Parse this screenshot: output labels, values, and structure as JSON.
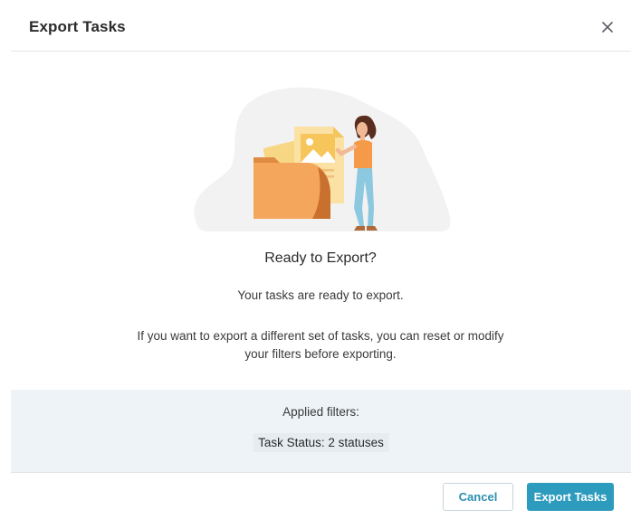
{
  "dialog": {
    "title": "Export Tasks",
    "close_icon": "close-icon"
  },
  "illustration": {
    "icon": "folder-with-documents-illustration"
  },
  "content": {
    "heading": "Ready to Export?",
    "description": "Your tasks are ready to export.",
    "hint_line1": "If you want to export a different set of tasks, you can reset or modify",
    "hint_line2": "your filters before exporting."
  },
  "filters": {
    "label": "Applied filters:",
    "chips": [
      "Task Status: 2 statuses"
    ]
  },
  "footer": {
    "cancel_label": "Cancel",
    "export_label": "Export Tasks"
  },
  "colors": {
    "accent": "#2d9bbd",
    "filters_bg": "#edf3f6"
  }
}
